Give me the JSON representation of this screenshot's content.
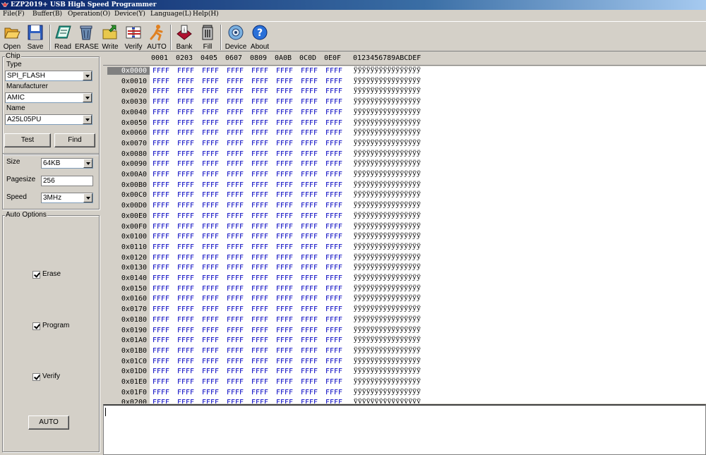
{
  "window": {
    "title": "EZP2019+ USB High Speed Programmer"
  },
  "menu": [
    "File(F)",
    "Buffer(B)",
    "Operation(O)",
    "Device(Y)",
    "Language(L)",
    "Help(H)"
  ],
  "toolbar": {
    "open": "Open",
    "save": "Save",
    "read": "Read",
    "erase": "ERASE",
    "write": "Write",
    "verify": "Verify",
    "auto": "AUTO",
    "bank": "Bank",
    "fill": "Fill",
    "device": "Device",
    "about": "About"
  },
  "chip": {
    "group_title": "Chip",
    "type_label": "Type",
    "type_value": "SPI_FLASH",
    "manufacturer_label": "Manufacturer",
    "manufacturer_value": "AMIC",
    "name_label": "Name",
    "name_value": "A25L05PU",
    "test_button": "Test",
    "find_button": "Find"
  },
  "settings": {
    "size_label": "Size",
    "size_value": "64KB",
    "pagesize_label": "Pagesize",
    "pagesize_value": "256",
    "speed_label": "Speed",
    "speed_value": "3MHz"
  },
  "auto_options": {
    "group_title": "Auto Options",
    "erase_label": "Erase",
    "erase_checked": true,
    "program_label": "Program",
    "program_checked": true,
    "verify_label": "Verify",
    "verify_checked": true,
    "auto_button": "AUTO"
  },
  "hex": {
    "header_columns": [
      "0001",
      "0203",
      "0405",
      "0607",
      "0809",
      "0A0B",
      "0C0D",
      "0E0F"
    ],
    "header_ascii": "0123456789ABCDEF",
    "selected_address": "0x0000",
    "addresses": [
      "0x0000",
      "0x0010",
      "0x0020",
      "0x0030",
      "0x0040",
      "0x0050",
      "0x0060",
      "0x0070",
      "0x0080",
      "0x0090",
      "0x00A0",
      "0x00B0",
      "0x00C0",
      "0x00D0",
      "0x00E0",
      "0x00F0",
      "0x0100",
      "0x0110",
      "0x0120",
      "0x0130",
      "0x0140",
      "0x0150",
      "0x0160",
      "0x0170",
      "0x0180",
      "0x0190",
      "0x01A0",
      "0x01B0",
      "0x01C0",
      "0x01D0",
      "0x01E0",
      "0x01F0",
      "0x0200"
    ],
    "cell_value": "FFFF",
    "ascii_value": "ÿÿÿÿÿÿÿÿÿÿÿÿÿÿÿÿ"
  },
  "colors": {
    "hex_text": "#0000c0",
    "title_start": "#0a246a",
    "title_end": "#a6caf0",
    "face": "#d4d0c8"
  }
}
